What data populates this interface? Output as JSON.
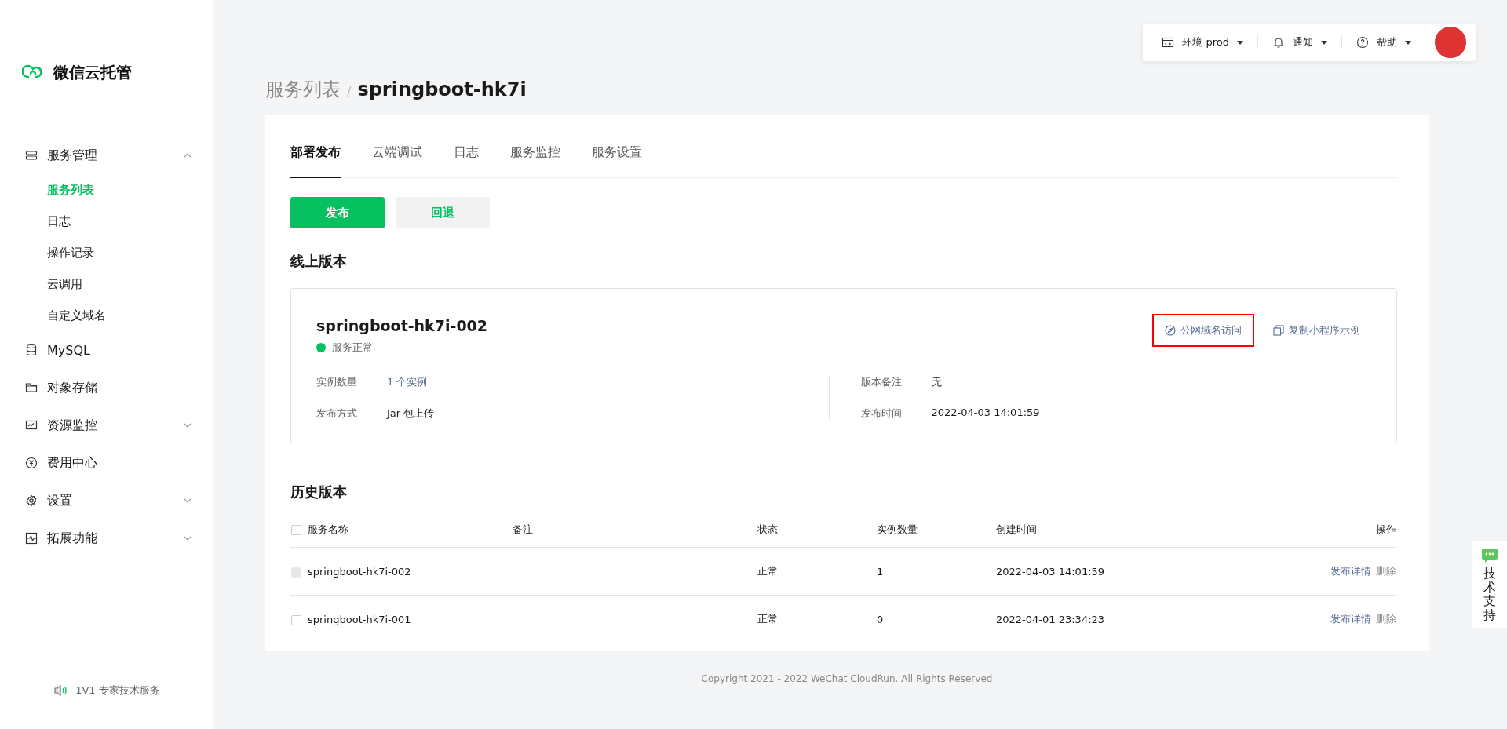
{
  "brand": {
    "name": "微信云托管"
  },
  "sidebar": {
    "items": [
      {
        "label": "服务管理",
        "expanded": true,
        "children": [
          {
            "label": "服务列表",
            "selected": true
          },
          {
            "label": "日志",
            "selected": false
          },
          {
            "label": "操作记录",
            "selected": false
          },
          {
            "label": "云调用",
            "selected": false
          },
          {
            "label": "自定义域名",
            "selected": false
          }
        ]
      },
      {
        "label": "MySQL"
      },
      {
        "label": "对象存储"
      },
      {
        "label": "资源监控",
        "expanded": false
      },
      {
        "label": "费用中心"
      },
      {
        "label": "设置",
        "expanded": false
      },
      {
        "label": "拓展功能",
        "expanded": false
      }
    ],
    "footer": "1V1 专家技术服务"
  },
  "topbar": {
    "items": [
      {
        "label": "环境 prod"
      },
      {
        "label": "通知"
      },
      {
        "label": "帮助"
      }
    ]
  },
  "breadcrumb": {
    "parent": "服务列表",
    "separator": "/",
    "current": "springboot-hk7i"
  },
  "tabs": [
    {
      "label": "部署发布",
      "selected": true
    },
    {
      "label": "云端调试",
      "selected": false
    },
    {
      "label": "日志",
      "selected": false
    },
    {
      "label": "服务监控",
      "selected": false
    },
    {
      "label": "服务设置",
      "selected": false
    }
  ],
  "buttons": [
    {
      "label": "发布",
      "kind": "primary"
    },
    {
      "label": "回退",
      "kind": "secondary"
    }
  ],
  "online": {
    "heading": "线上版本",
    "name": "springboot-hk7i-002",
    "status": "服务正常",
    "actions": [
      {
        "label": "公网域名访问",
        "highlighted": true
      },
      {
        "label": "复制小程序示例",
        "highlighted": false
      }
    ],
    "left_fields": [
      {
        "label": "实例数量",
        "value": "1 个实例",
        "link": true
      },
      {
        "label": "发布方式",
        "value": "Jar 包上传",
        "link": false
      }
    ],
    "right_fields": [
      {
        "label": "版本备注",
        "value": "无",
        "link": false
      },
      {
        "label": "发布时间",
        "value": "2022-04-03 14:01:59",
        "link": false
      }
    ]
  },
  "history": {
    "heading": "历史版本",
    "header_checked": false,
    "columns": [
      "服务名称",
      "备注",
      "状态",
      "实例数量",
      "创建时间",
      "操作"
    ],
    "rows": [
      {
        "name": "springboot-hk7i-002",
        "status": "正常",
        "instances": "1",
        "created": "2022-04-03 14:01:59",
        "actions": [
          "发布详情",
          "删除"
        ],
        "checked": false,
        "disabled": true
      },
      {
        "name": "springboot-hk7i-001",
        "status": "正常",
        "instances": "0",
        "created": "2022-04-01 23:34:23",
        "actions": [
          "发布详情",
          "删除"
        ],
        "checked": false,
        "disabled": false
      }
    ]
  },
  "footer": "Copyright 2021 - 2022 WeChat CloudRun. All Rights Reserved",
  "support": {
    "label": "技术支持"
  }
}
